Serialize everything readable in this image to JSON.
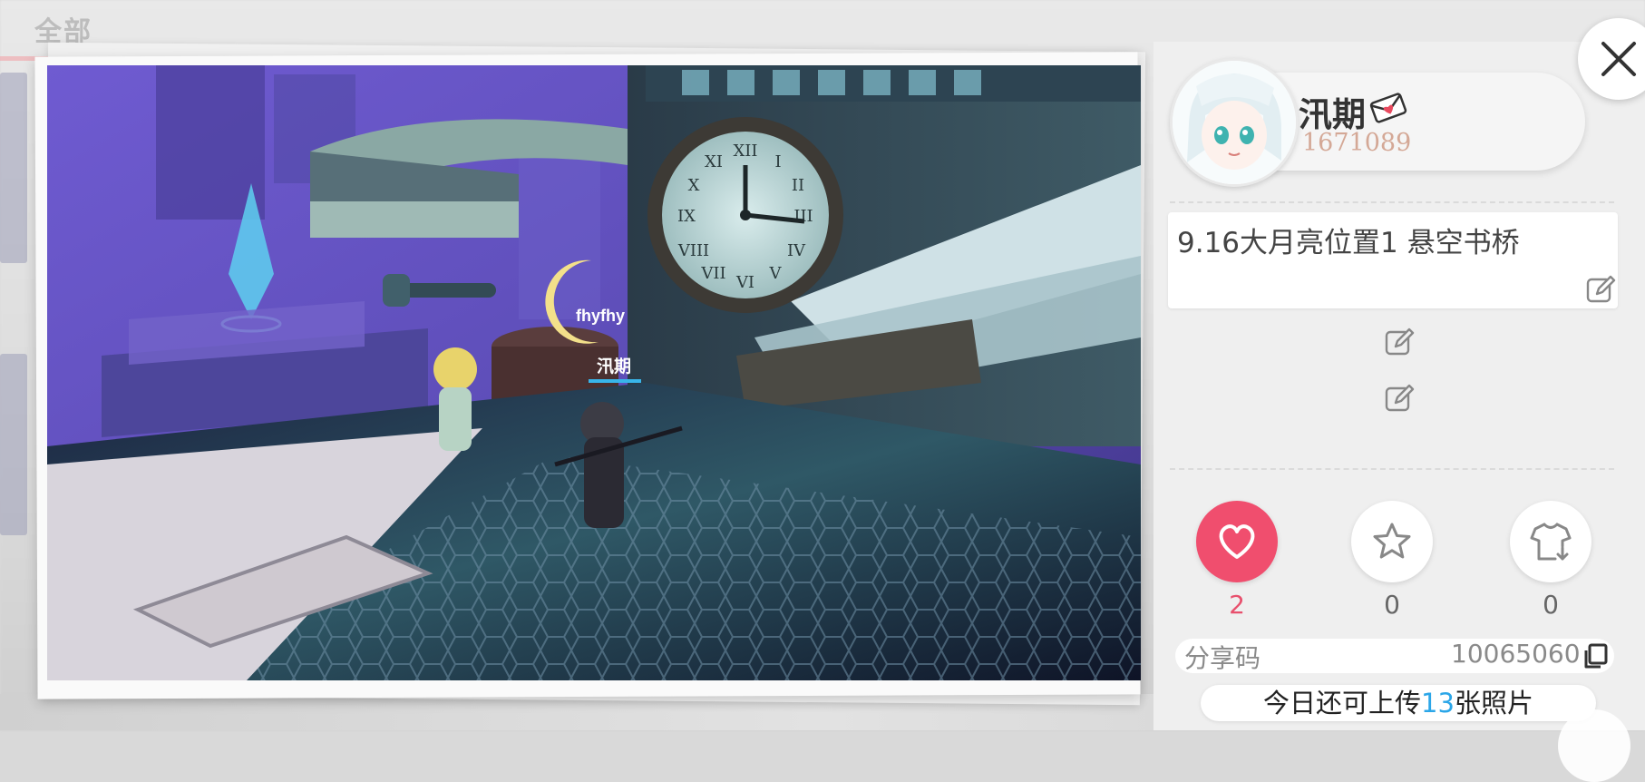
{
  "background": {
    "tab_label": "全部"
  },
  "photo": {
    "alt": "game screenshot",
    "name_tags": [
      "fhyfhy",
      "汛期"
    ]
  },
  "profile": {
    "username": "汛期",
    "user_id": "1671089"
  },
  "post": {
    "description": "9.16大月亮位置1 悬空书桥"
  },
  "actions": {
    "like": {
      "count": "2",
      "icon": "heart-icon",
      "color": "#f04e6e"
    },
    "favorite": {
      "count": "0",
      "icon": "star-icon"
    },
    "outfit": {
      "count": "0",
      "icon": "shirt-download-icon"
    }
  },
  "share": {
    "label": "分享码",
    "code": "10065060"
  },
  "upload": {
    "prefix": "今日还可上传",
    "count": "13",
    "suffix": "张照片"
  },
  "colors": {
    "accent_pink": "#f04e6e",
    "accent_blue": "#2ba6e8",
    "id_color": "#d4a896"
  }
}
